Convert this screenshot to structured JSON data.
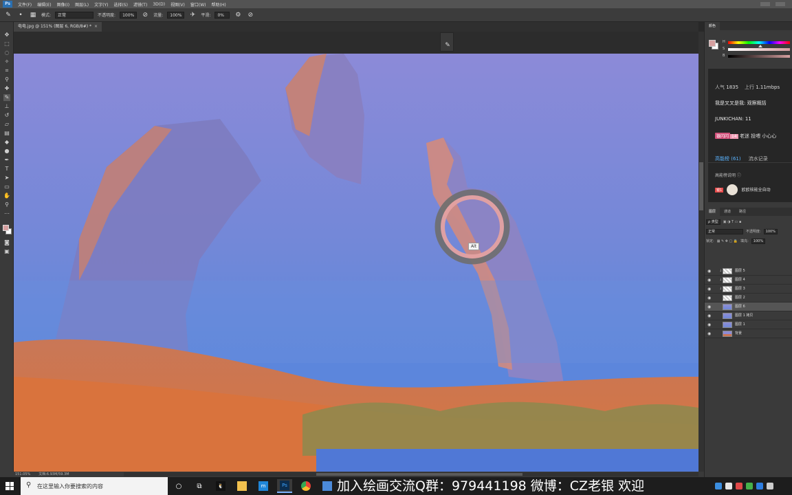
{
  "menubar": {
    "logo": "Ps",
    "items": [
      "文件(F)",
      "编辑(E)",
      "图像(I)",
      "图层(L)",
      "文字(Y)",
      "选择(S)",
      "滤镜(T)",
      "3D(D)",
      "视图(V)",
      "窗口(W)",
      "帮助(H)"
    ]
  },
  "options": {
    "mode_label": "模式:",
    "mode_value": "正常",
    "opacity_label": "不透明度:",
    "opacity_value": "100%",
    "flow_label": "流量:",
    "flow_value": "100%",
    "smooth_label": "平滑:",
    "smooth_value": "0%"
  },
  "document": {
    "tab_title": "电电.jpg @ 151% (图层 6, RGB/8#) *",
    "close": "×"
  },
  "canvas": {
    "alt_tooltip": "Alt"
  },
  "status": {
    "zoom": "151.05%",
    "doc_info": "文档:6.93M/59.3M"
  },
  "color_panel": {
    "tab": "颜色",
    "h": "H",
    "s": "S",
    "b": "B",
    "fg_color": "#d6a0a0",
    "hue_position": 0.5
  },
  "stream": {
    "popularity_label": "人气",
    "popularity_value": "1835",
    "upload_label": "上行",
    "upload_value": "1.11mbps",
    "messages": [
      {
        "text": "我是叉叉是我: 观察概括"
      },
      {
        "text": "JUNKICHAN: 11"
      }
    ],
    "fan_badge": "银闪闪",
    "fan_level": "14",
    "fan_message": "老迷 投喂 小心心",
    "tabs": [
      "高能榜 (61)",
      "流水记录"
    ],
    "help": "高能榜说明 ⓘ",
    "gift_badge": "银1",
    "gift_user": "欧欧核能全自动"
  },
  "layers_panel": {
    "tabs": [
      "图层",
      "通道",
      "路径"
    ],
    "filter": "ρ 类型",
    "blend": "正常",
    "opacity_label": "不透明度:",
    "opacity_value": "100%",
    "lock_label": "锁定:",
    "fill_label": "填充:",
    "fill_value": "100%",
    "layers": [
      {
        "name": "图层 5",
        "thumb": "trans",
        "clip": true,
        "selected": false
      },
      {
        "name": "图层 4",
        "thumb": "trans",
        "clip": true,
        "selected": false
      },
      {
        "name": "图层 3",
        "thumb": "trans",
        "clip": true,
        "selected": false
      },
      {
        "name": "图层 2",
        "thumb": "trans",
        "clip": false,
        "selected": false
      },
      {
        "name": "图层 6",
        "thumb": "sky",
        "clip": false,
        "selected": true
      },
      {
        "name": "图层 1 拷贝",
        "thumb": "sky",
        "clip": false,
        "selected": false
      },
      {
        "name": "图层 1",
        "thumb": "sky",
        "clip": false,
        "selected": false
      },
      {
        "name": "背景",
        "thumb": "desert",
        "clip": false,
        "selected": false
      }
    ]
  },
  "taskbar": {
    "search_placeholder": "在这里输入你要搜索的内容",
    "ps_label": "Ps",
    "banner": "加入绘画交流Q群：979441198  微博：CZ老银  欢迎"
  }
}
